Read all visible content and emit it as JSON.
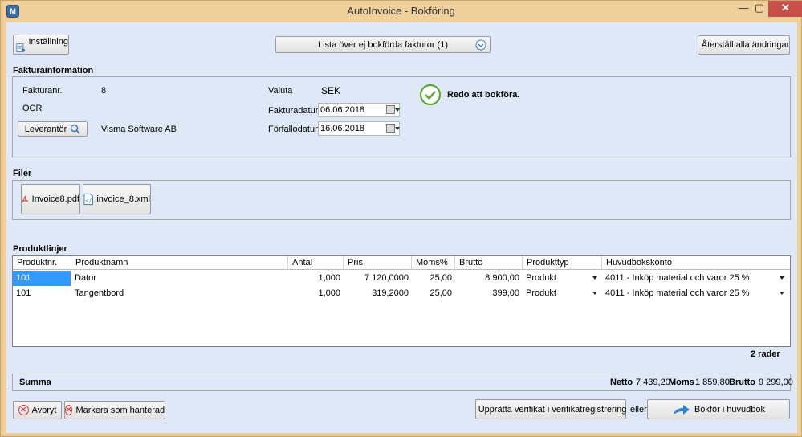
{
  "window": {
    "title": "AutoInvoice  - Bokföring",
    "app_icon": "M",
    "min": "—",
    "max": "▢",
    "close": "✕"
  },
  "toolbar": {
    "settings_label": "Inställning",
    "invoice_list_label": "Lista över ej bokförda fakturor (1)",
    "reset_label": "Återställ alla ändringar"
  },
  "invoice_info": {
    "section_title": "Fakturainformation",
    "invoice_no_label": "Fakturanr.",
    "invoice_no": "8",
    "ocr_label": "OCR",
    "supplier_button": "Leverantör",
    "supplier_name": "Visma Software AB",
    "currency_label": "Valuta",
    "currency": "SEK",
    "invoice_date_label": "Fakturadatum",
    "invoice_date": "06.06.2018",
    "due_date_label": "Förfallodatum",
    "due_date": "16.06.2018",
    "status": "Redo att bokföra.",
    "status_color": "#5aa832"
  },
  "files": {
    "section_title": "Filer",
    "items": [
      {
        "name": "Invoice8.pdf",
        "icon": "pdf-icon"
      },
      {
        "name": "invoice_8.xml",
        "icon": "xml-icon"
      }
    ]
  },
  "product_lines": {
    "section_title": "Produktlinjer",
    "columns": [
      "Produktnr.",
      "Produktnamn",
      "Antal",
      "Pris",
      "Moms%",
      "Brutto",
      "Produkttyp",
      "Huvudbokskonto"
    ],
    "rows": [
      {
        "nr": "101",
        "name": "Dator",
        "qty": "1,000",
        "price": "7 120,0000",
        "vat": "25,00",
        "gross": "8 900,00",
        "type": "Produkt",
        "account": "4011 - Inköp material och varor 25 %"
      },
      {
        "nr": "101",
        "name": "Tangentbord",
        "qty": "1,000",
        "price": "319,2000",
        "vat": "25,00",
        "gross": "399,00",
        "type": "Produkt",
        "account": "4011 - Inköp material och varor 25 %"
      }
    ],
    "row_count": "2 rader"
  },
  "summary": {
    "label": "Summa",
    "net_label": "Netto",
    "net": "7 439,20",
    "vat_label": "Moms",
    "vat": "1 859,80",
    "gross_label": "Brutto",
    "gross": "9 299,00"
  },
  "footer": {
    "cancel_label": "Avbryt",
    "mark_handled_label": "Markera som hanterad",
    "create_voucher_label": "Upprätta verifikat i verifikatregistrering",
    "or_label": "eller",
    "post_label": "Bokför i huvudbok"
  }
}
